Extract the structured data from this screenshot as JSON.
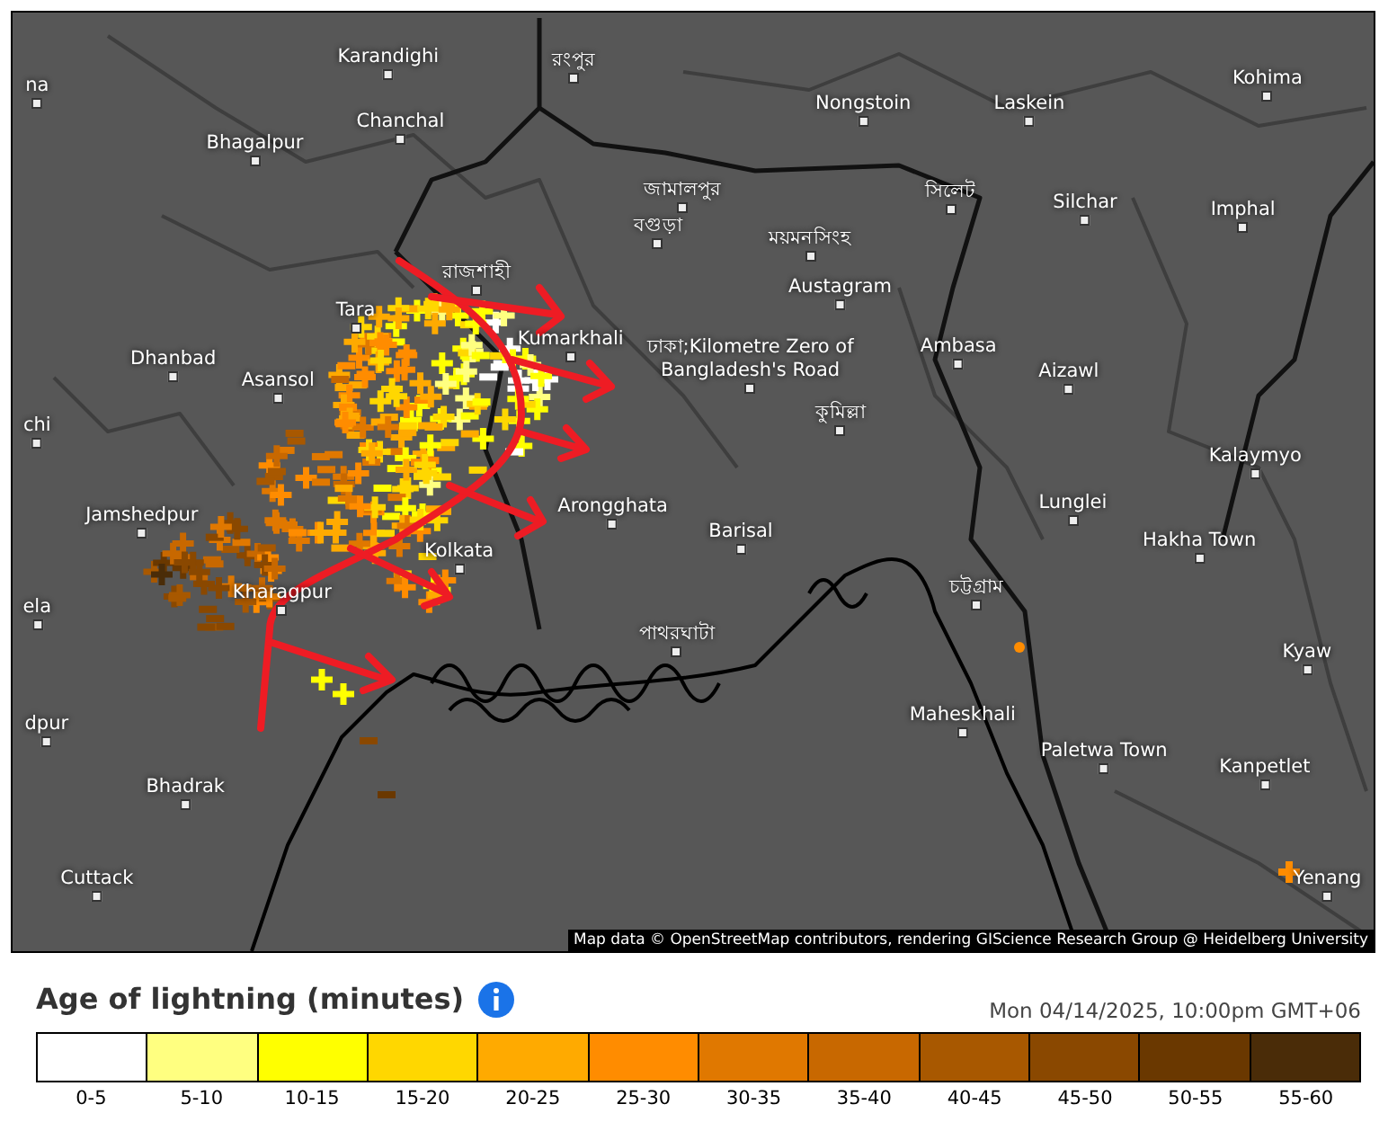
{
  "map": {
    "places": [
      {
        "name": "na"
      },
      {
        "name": "Karandighi"
      },
      {
        "name": "রংপুর"
      },
      {
        "name": "Chanchal"
      },
      {
        "name": "Bhagalpur"
      },
      {
        "name": "Nongstoin"
      },
      {
        "name": "Laskein"
      },
      {
        "name": "Kohima"
      },
      {
        "name": "জামালপুর"
      },
      {
        "name": "সিলেট"
      },
      {
        "name": "Silchar"
      },
      {
        "name": "Imphal"
      },
      {
        "name": "বগুড়া"
      },
      {
        "name": "ময়মনসিংহ"
      },
      {
        "name": "রাজশাহী"
      },
      {
        "name": "Austagram"
      },
      {
        "name": "ঢাকা;Kilometre Zero of Bangladesh's Road"
      },
      {
        "name": "Tara"
      },
      {
        "name": "Ambasa"
      },
      {
        "name": "Aizawl"
      },
      {
        "name": "Dhanbad"
      },
      {
        "name": "Asansol"
      },
      {
        "name": "Kumarkhali"
      },
      {
        "name": "কুমিল্লা"
      },
      {
        "name": "chi"
      },
      {
        "name": "Kalaymyo"
      },
      {
        "name": "Jamshedpur"
      },
      {
        "name": "Arongghata"
      },
      {
        "name": "Barisal"
      },
      {
        "name": "Lunglei"
      },
      {
        "name": "Hakha Town"
      },
      {
        "name": "Kolkata"
      },
      {
        "name": "Kharagpur"
      },
      {
        "name": "চট্টগ্রাম"
      },
      {
        "name": "ela"
      },
      {
        "name": "পাথরঘাটা"
      },
      {
        "name": "Kyaw"
      },
      {
        "name": "Maheskhali"
      },
      {
        "name": "dpur"
      },
      {
        "name": "Paletwa Town"
      },
      {
        "name": "Kanpetlet"
      },
      {
        "name": "Bhadrak"
      },
      {
        "name": "Cuttack"
      },
      {
        "name": "Yenang"
      }
    ],
    "attribution": "Map data © OpenStreetMap contributors, rendering GIScience Research Group @ Heidelberg University"
  },
  "legend": {
    "title": "Age of lightning (minutes)",
    "timestamp": "Mon 04/14/2025, 10:00pm GMT+06",
    "bins": [
      {
        "label": "0-5",
        "color": "#ffffff"
      },
      {
        "label": "5-10",
        "color": "#ffff80"
      },
      {
        "label": "10-15",
        "color": "#ffff00"
      },
      {
        "label": "15-20",
        "color": "#ffd700"
      },
      {
        "label": "20-25",
        "color": "#ffaa00"
      },
      {
        "label": "25-30",
        "color": "#ff8c00"
      },
      {
        "label": "30-35",
        "color": "#e07800"
      },
      {
        "label": "35-40",
        "color": "#c86800"
      },
      {
        "label": "40-45",
        "color": "#a85800"
      },
      {
        "label": "45-50",
        "color": "#8a4800"
      },
      {
        "label": "50-55",
        "color": "#6a3800"
      },
      {
        "label": "55-60",
        "color": "#4a2c08"
      }
    ]
  }
}
